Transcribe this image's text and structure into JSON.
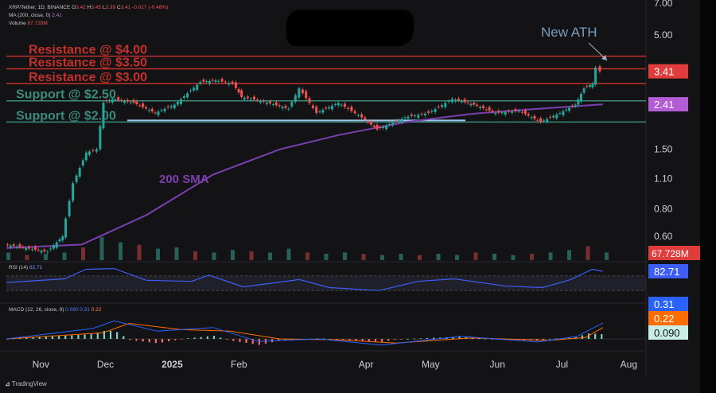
{
  "header": {
    "symbol_line": "XRP/Tether, 1D, BINANCE",
    "ohlc": [
      {
        "k": "O",
        "v": "3.42"
      },
      {
        "k": "H",
        "v": "3.45"
      },
      {
        "k": "L",
        "v": "3.39"
      },
      {
        "k": "C",
        "v": "3.41"
      }
    ],
    "change": "-0.017 (-0.48%)",
    "ma_label": "MA (200, close, 0)",
    "ma_value": "2.41",
    "volume_label": "Volume",
    "volume_value": "67.728M"
  },
  "colors": {
    "up": "#26a69a",
    "down": "#ef5350",
    "resistance": "#c4302b",
    "support": "#3c8a7c",
    "sma": "#7b3fb0",
    "rsi": "#3d5ef5",
    "macd": "#2962ff",
    "signal": "#ff6d00",
    "annotation_text": "#c4302b",
    "support_text": "#3c8a7c",
    "ath_text": "#7a9cc0"
  },
  "chart_data": {
    "type": "candlestick",
    "symbol": "XRP/Tether",
    "timeframe": "1D",
    "exchange": "BINANCE",
    "y_scale": "log",
    "price_axis_ticks": [
      "7.00",
      "5.00",
      "1.50",
      "1.10",
      "0.80",
      "0.60"
    ],
    "time_axis_labels": [
      "Nov",
      "Dec",
      "2025",
      "Feb",
      "Apr",
      "May",
      "Jun",
      "Jul",
      "Aug"
    ],
    "annotations": {
      "levels": [
        {
          "label": "Resistance @ $4.00",
          "price": 4.0,
          "kind": "resistance"
        },
        {
          "label": "Resistance @ $3.50",
          "price": 3.5,
          "kind": "resistance"
        },
        {
          "label": "Resistance @ $3.00",
          "price": 3.0,
          "kind": "resistance"
        },
        {
          "label": "Support @ $2.50",
          "price": 2.5,
          "kind": "support"
        },
        {
          "label": "Support @ $2.00",
          "price": 2.0,
          "kind": "support"
        }
      ],
      "sma_label": "200 SMA",
      "ath_label": "New ATH"
    },
    "price_path": [
      {
        "date": "2024-10-16",
        "price": 0.55
      },
      {
        "date": "2024-11-05",
        "price": 0.51
      },
      {
        "date": "2024-11-12",
        "price": 0.6
      },
      {
        "date": "2024-11-17",
        "price": 1.05
      },
      {
        "date": "2024-11-23",
        "price": 1.45
      },
      {
        "date": "2024-11-28",
        "price": 1.5
      },
      {
        "date": "2024-12-01",
        "price": 2.45
      },
      {
        "date": "2024-12-05",
        "price": 2.55
      },
      {
        "date": "2024-12-15",
        "price": 2.45
      },
      {
        "date": "2024-12-25",
        "price": 2.2
      },
      {
        "date": "2025-01-03",
        "price": 2.4
      },
      {
        "date": "2025-01-15",
        "price": 3.05
      },
      {
        "date": "2025-01-22",
        "price": 3.1
      },
      {
        "date": "2025-01-30",
        "price": 3.0
      },
      {
        "date": "2025-02-03",
        "price": 2.6
      },
      {
        "date": "2025-02-12",
        "price": 2.5
      },
      {
        "date": "2025-02-25",
        "price": 2.3
      },
      {
        "date": "2025-03-02",
        "price": 2.85
      },
      {
        "date": "2025-03-10",
        "price": 2.2
      },
      {
        "date": "2025-03-20",
        "price": 2.45
      },
      {
        "date": "2025-03-31",
        "price": 2.1
      },
      {
        "date": "2025-04-07",
        "price": 1.85
      },
      {
        "date": "2025-04-20",
        "price": 2.1
      },
      {
        "date": "2025-05-01",
        "price": 2.2
      },
      {
        "date": "2025-05-12",
        "price": 2.55
      },
      {
        "date": "2025-05-22",
        "price": 2.4
      },
      {
        "date": "2025-06-01",
        "price": 2.2
      },
      {
        "date": "2025-06-12",
        "price": 2.25
      },
      {
        "date": "2025-06-22",
        "price": 2.0
      },
      {
        "date": "2025-07-01",
        "price": 2.2
      },
      {
        "date": "2025-07-08",
        "price": 2.4
      },
      {
        "date": "2025-07-12",
        "price": 2.85
      },
      {
        "date": "2025-07-16",
        "price": 3.0
      },
      {
        "date": "2025-07-18",
        "price": 3.55
      },
      {
        "date": "2025-07-20",
        "price": 3.41
      }
    ],
    "sma_200_path": [
      {
        "date": "2024-10-16",
        "price": 0.53
      },
      {
        "date": "2024-11-20",
        "price": 0.55
      },
      {
        "date": "2024-12-20",
        "price": 0.75
      },
      {
        "date": "2025-01-20",
        "price": 1.15
      },
      {
        "date": "2025-02-20",
        "price": 1.5
      },
      {
        "date": "2025-03-20",
        "price": 1.75
      },
      {
        "date": "2025-04-20",
        "price": 2.0
      },
      {
        "date": "2025-05-20",
        "price": 2.18
      },
      {
        "date": "2025-06-20",
        "price": 2.3
      },
      {
        "date": "2025-07-20",
        "price": 2.41
      }
    ],
    "last_price": "3.41",
    "sma_last": "2.41",
    "volume_last": "67.728M",
    "volume_relative": [
      0.3,
      0.2,
      0.25,
      0.3,
      0.5,
      0.9,
      0.7,
      0.6,
      0.45,
      0.5,
      0.35,
      0.3,
      0.4,
      0.35,
      0.3,
      0.45,
      0.3,
      0.25,
      0.3,
      0.25,
      0.2,
      0.25,
      0.2,
      0.25,
      0.2,
      0.3,
      0.25,
      0.2,
      0.25,
      0.3,
      0.4,
      0.55,
      0.3
    ],
    "rsi": {
      "label": "RSI (14)",
      "value": "82.71",
      "path": [
        {
          "date": "2024-10-16",
          "v": 52
        },
        {
          "date": "2024-11-12",
          "v": 62
        },
        {
          "date": "2024-11-22",
          "v": 88
        },
        {
          "date": "2024-12-05",
          "v": 90
        },
        {
          "date": "2024-12-20",
          "v": 58
        },
        {
          "date": "2025-01-10",
          "v": 55
        },
        {
          "date": "2025-01-18",
          "v": 72
        },
        {
          "date": "2025-02-03",
          "v": 40
        },
        {
          "date": "2025-03-01",
          "v": 60
        },
        {
          "date": "2025-03-15",
          "v": 38
        },
        {
          "date": "2025-04-07",
          "v": 30
        },
        {
          "date": "2025-04-25",
          "v": 55
        },
        {
          "date": "2025-05-12",
          "v": 62
        },
        {
          "date": "2025-06-05",
          "v": 42
        },
        {
          "date": "2025-06-22",
          "v": 38
        },
        {
          "date": "2025-07-05",
          "v": 60
        },
        {
          "date": "2025-07-15",
          "v": 88
        },
        {
          "date": "2025-07-20",
          "v": 82.71
        }
      ]
    },
    "macd": {
      "label": "MACD (12, 26, close, 9)",
      "macd_value": "0.090",
      "signal_value": "0.22",
      "hist_value": "0.31",
      "macd_path": [
        {
          "date": "2024-10-16",
          "v": 0.0
        },
        {
          "date": "2024-11-25",
          "v": 0.2
        },
        {
          "date": "2024-12-05",
          "v": 0.35
        },
        {
          "date": "2024-12-25",
          "v": 0.15
        },
        {
          "date": "2025-01-20",
          "v": 0.22
        },
        {
          "date": "2025-02-10",
          "v": -0.05
        },
        {
          "date": "2025-03-10",
          "v": 0.0
        },
        {
          "date": "2025-04-08",
          "v": -0.12
        },
        {
          "date": "2025-05-15",
          "v": 0.05
        },
        {
          "date": "2025-06-20",
          "v": -0.06
        },
        {
          "date": "2025-07-08",
          "v": 0.05
        },
        {
          "date": "2025-07-20",
          "v": 0.31
        }
      ],
      "signal_path": [
        {
          "date": "2024-10-16",
          "v": 0.0
        },
        {
          "date": "2024-11-30",
          "v": 0.12
        },
        {
          "date": "2024-12-12",
          "v": 0.3
        },
        {
          "date": "2025-01-05",
          "v": 0.18
        },
        {
          "date": "2025-01-28",
          "v": 0.15
        },
        {
          "date": "2025-02-20",
          "v": 0.0
        },
        {
          "date": "2025-03-20",
          "v": -0.02
        },
        {
          "date": "2025-04-15",
          "v": -0.08
        },
        {
          "date": "2025-05-20",
          "v": 0.02
        },
        {
          "date": "2025-06-25",
          "v": -0.03
        },
        {
          "date": "2025-07-12",
          "v": 0.03
        },
        {
          "date": "2025-07-20",
          "v": 0.22
        }
      ]
    }
  },
  "watermark": "TradingView"
}
